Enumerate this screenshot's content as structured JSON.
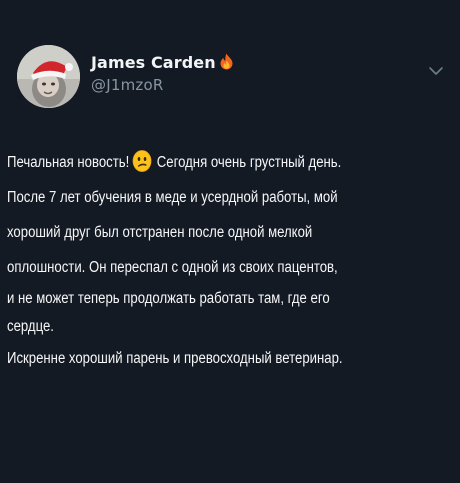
{
  "author": {
    "display_name": "James Carden",
    "name_emoji": "fire-icon",
    "handle": "@J1mzoR",
    "avatar": "user-avatar-santa-hat"
  },
  "menu": {
    "icon": "chevron-down-icon"
  },
  "tweet": {
    "line1_before": "Печальная новость!",
    "line1_emoji": "confused-face-icon",
    "line1_after": "Сегодня очень грустный день.",
    "line2": "После 7 лет обучения в меде и усердной работы, мой",
    "line3": "хороший друг был отстранен после одной мелкой",
    "line4": "оплошности. Он переспал с одной из своих пацентов,",
    "line5": "и не может теперь продолжать работать там, где его",
    "line6": "сердце.",
    "line7": "Искренне хороший парень и превосходный ветеринар."
  },
  "colors": {
    "background": "#141a24",
    "text": "#f6f7f8",
    "secondary": "#8795a3"
  }
}
